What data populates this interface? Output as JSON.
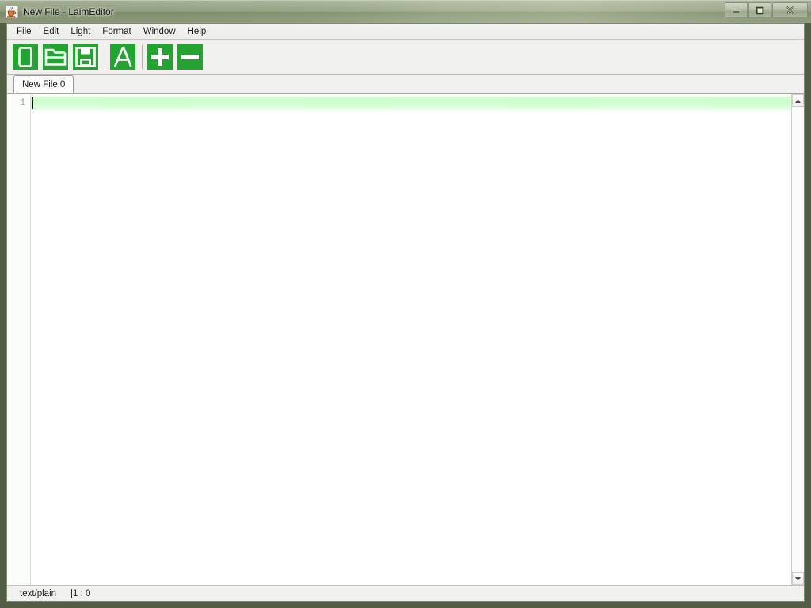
{
  "window": {
    "title": "New File - LaimEditor",
    "app_icon": "java-coffee-cup-icon",
    "controls": {
      "minimize_label": "–",
      "maximize_label": "□",
      "close_label": "✕"
    }
  },
  "menubar": {
    "items": [
      {
        "label": "File",
        "name": "menu-file"
      },
      {
        "label": "Edit",
        "name": "menu-edit"
      },
      {
        "label": "Light",
        "name": "menu-light"
      },
      {
        "label": "Format",
        "name": "menu-format"
      },
      {
        "label": "Window",
        "name": "menu-window"
      },
      {
        "label": "Help",
        "name": "menu-help"
      }
    ]
  },
  "toolbar": {
    "buttons": [
      {
        "icon": "new-file-icon",
        "tooltip": "New File"
      },
      {
        "icon": "open-folder-icon",
        "tooltip": "Open"
      },
      {
        "icon": "save-floppy-icon",
        "tooltip": "Save"
      },
      {
        "icon": "font-letter-a-icon",
        "tooltip": "Font"
      },
      {
        "icon": "zoom-in-plus-icon",
        "tooltip": "Increase Font Size"
      },
      {
        "icon": "zoom-out-minus-icon",
        "tooltip": "Decrease Font Size"
      }
    ],
    "accent_color": "#22a52e"
  },
  "tabs": [
    {
      "label": "New File 0",
      "active": true
    }
  ],
  "editor": {
    "line_numbers": [
      "1"
    ],
    "content": "",
    "current_line_highlight": "#ccffcc",
    "background": "#ffffff"
  },
  "scrollbar": {
    "up_arrow": "▲",
    "down_arrow": "▼"
  },
  "statusbar": {
    "content_type": "text/plain",
    "caret_position": "|1 : 0"
  }
}
